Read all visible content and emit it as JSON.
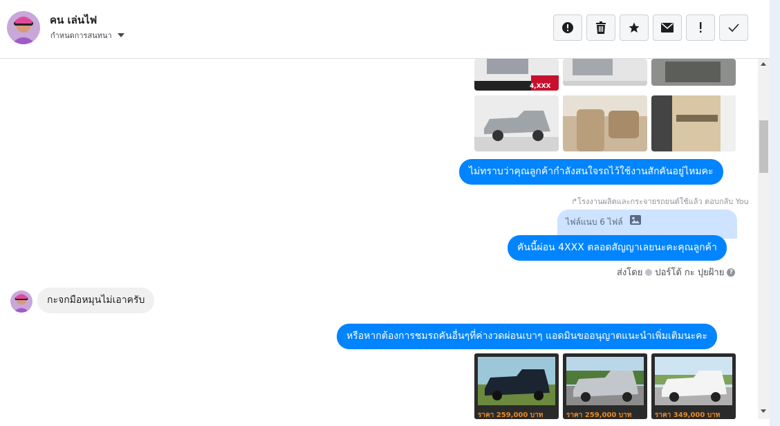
{
  "header": {
    "name": "คน เล่นไฟ",
    "subtitle": "กำหนดการสนทนา",
    "toolbar": [
      {
        "icon": "alert-circle-icon",
        "label": "spam"
      },
      {
        "icon": "trash-icon",
        "label": "delete"
      },
      {
        "icon": "star-icon",
        "label": "star"
      },
      {
        "icon": "envelope-icon",
        "label": "mark unread"
      },
      {
        "icon": "exclamation-icon",
        "label": "follow up"
      },
      {
        "icon": "check-icon",
        "label": "done"
      }
    ]
  },
  "messages": {
    "thumb_top_left_text": "4,XXX",
    "bubble1": "ไม่ทราบว่าคุณลูกค้ากำลังสนใจรถไว้ใช้งานสักคันอยู่ไหมคะ",
    "reply_meta": "โรงงานผลิตและกระจายรถยนต์ใช้แล้ว ตอบกลับ You",
    "attachment_label": "ไฟล์แนบ 6 ไฟล์",
    "bubble2": "คันนี้ผ่อน 4XXX ตลอดสัญญาเลยนะคะคุณลูกค้า",
    "sent_by_label": "ส่งโดย",
    "sent_by_name": "ปอร์โต้ กะ ปุยฝ้าย",
    "incoming": "กะจกมือหมุนไม่เอาครับ",
    "bubble3": "หรือหากต้องการชมรถคันอื่นๆที่ค่างวดผ่อนเบาๆ แอดมินขออนุญาตแนะนำเพิ่มเติมนะคะ",
    "promo_prices": [
      "ราคา 259,000 บาท",
      "ราคา 259,000 บาท",
      "ราคา 349,000 บาท"
    ]
  },
  "colors": {
    "accent": "#0084ff",
    "attachment_bg": "#cde3ff",
    "incoming_bg": "#f1f0f0"
  }
}
